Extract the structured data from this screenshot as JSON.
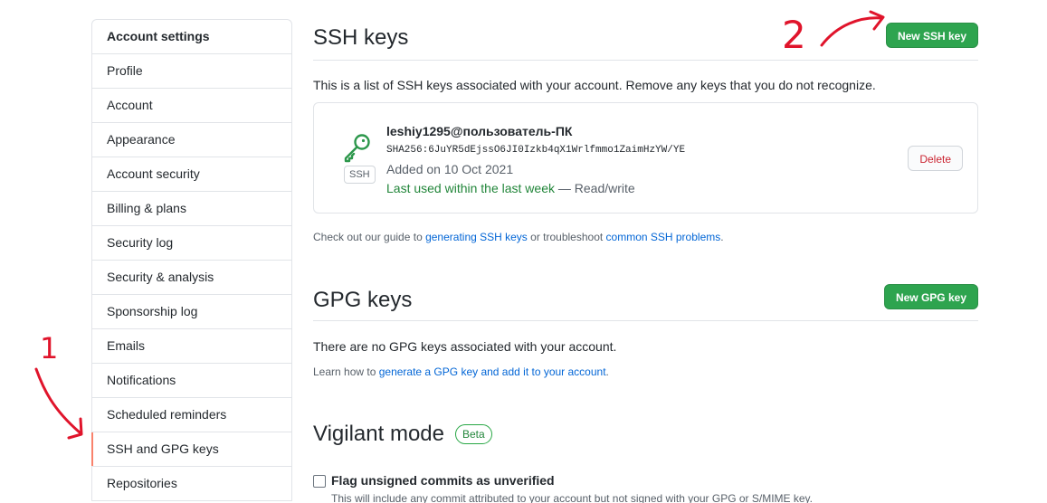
{
  "sidebar": {
    "header": "Account settings",
    "items": [
      {
        "label": "Profile"
      },
      {
        "label": "Account"
      },
      {
        "label": "Appearance"
      },
      {
        "label": "Account security"
      },
      {
        "label": "Billing & plans"
      },
      {
        "label": "Security log"
      },
      {
        "label": "Security & analysis"
      },
      {
        "label": "Sponsorship log"
      },
      {
        "label": "Emails"
      },
      {
        "label": "Notifications"
      },
      {
        "label": "Scheduled reminders"
      },
      {
        "label": "SSH and GPG keys",
        "selected": true
      },
      {
        "label": "Repositories"
      }
    ]
  },
  "ssh": {
    "title": "SSH keys",
    "new_button": "New SSH key",
    "description": "This is a list of SSH keys associated with your account. Remove any keys that you do not recognize.",
    "key": {
      "title": "leshiy1295@пользователь-ПК",
      "fingerprint": "SHA256:6JuYR5dEjssO6JI0Izkb4qX1Wrlfmmo1ZaimHzYW/YE",
      "added": "Added on 10 Oct 2021",
      "last_used": "Last used within the last week",
      "access": " — Read/write",
      "type_label": "SSH",
      "delete_label": "Delete",
      "icon": "key-icon"
    },
    "guide_prefix": "Check out our guide to ",
    "guide_link": "generating SSH keys",
    "guide_middle": " or troubleshoot ",
    "guide_link2": "common SSH problems",
    "guide_suffix": "."
  },
  "gpg": {
    "title": "GPG keys",
    "new_button": "New GPG key",
    "empty_text": "There are no GPG keys associated with your account.",
    "learn_prefix": "Learn how to ",
    "learn_link": "generate a GPG key and add it to your account",
    "learn_suffix": "."
  },
  "vigilant": {
    "title": "Vigilant mode",
    "badge": "Beta",
    "checkbox_label": "Flag unsigned commits as unverified",
    "checkbox_note": "This will include any commit attributed to your account but not signed with your GPG or S/MIME key."
  },
  "annotations": {
    "step1": "1",
    "step2": "2",
    "color": "#e0142b"
  },
  "colors": {
    "primary_button": "#2ea44f",
    "danger": "#cb2431",
    "link": "#0366d6",
    "success_text": "#22863a",
    "selected_marker": "#f9826c"
  }
}
